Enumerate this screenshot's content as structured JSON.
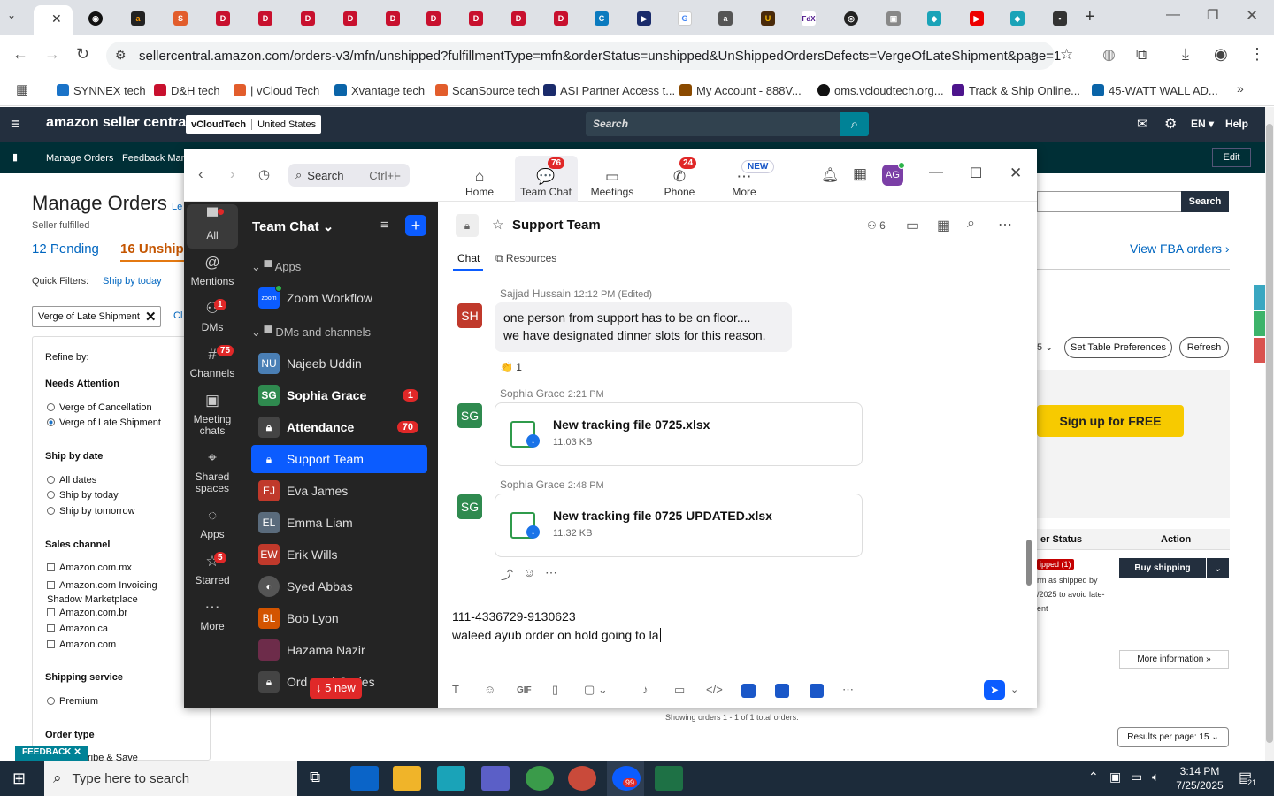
{
  "browser": {
    "url": "sellercentral.amazon.com/orders-v3/mfn/unshipped?fulfillmentType=mfn&orderStatus=unshipped&UnShippedOrdersDefects=VergeOfLateShipment&page=1",
    "bookmarks": [
      "SYNNEX tech",
      "D&H tech",
      "| vCloud Tech",
      "Xvantage tech",
      "ScanSource tech",
      "ASI Partner Access t...",
      "My Account - 888V...",
      "oms.vcloudtech.org...",
      "Track & Ship Online...",
      "45-WATT WALL AD..."
    ]
  },
  "amazon": {
    "logo": "amazon seller central",
    "store": "vCloudTech",
    "marketplace": "United States",
    "search_placeholder": "Search",
    "lang": "EN",
    "help": "Help",
    "nav": [
      "Manage Orders",
      "Feedback Man"
    ],
    "edit": "Edit",
    "page_title": "Manage Orders",
    "learn": "Le",
    "seller_fulfilled": "Seller fulfilled",
    "pending": "12 Pending",
    "unshipped": "16 Unship",
    "quick_filters": "Quick Filters:",
    "ship_today": "Ship by today",
    "filter_chip": "Verge of Late Shipment",
    "clear": "Cl",
    "search_btn": "Search",
    "view_fba": "View FBA orders ›",
    "refine_by": "Refine by:",
    "needs_attention": "Needs Attention",
    "verge_cancel": "Verge of Cancellation",
    "verge_late": "Verge of Late Shipment",
    "ship_by_date": "Ship by date",
    "all_dates": "All dates",
    "ship_today_opt": "Ship by today",
    "ship_tomorrow": "Ship by tomorrow",
    "sales_channel": "Sales channel",
    "channels": [
      "Amazon.com.mx",
      "Amazon.com Invoicing Shadow Marketplace",
      "Amazon.com.br",
      "Amazon.ca",
      "Amazon.com"
    ],
    "shipping_service": "Shipping service",
    "premium": "Premium",
    "order_type": "Order type",
    "subscribe": "scribe & Save",
    "feedback": "FEEDBACK",
    "per_page_partial": "5",
    "table_prefs": "Set Table Preferences",
    "refresh": "Refresh",
    "signup": "Sign up for FREE",
    "status_col": "er Status",
    "action_col": "Action",
    "status_badge": "ipped (1)",
    "status_note": "rm as shipped by /2025 to avoid late- ent",
    "buy_shipping": "Buy shipping",
    "more_info": "More information »",
    "showing": "Showing orders 1 - 1 of 1 total orders.",
    "results_per_page": "Results per page: 15"
  },
  "zoom": {
    "search_label": "Search",
    "search_shortcut": "Ctrl+F",
    "tabs": [
      {
        "label": "Home"
      },
      {
        "label": "Team Chat",
        "badge": "76"
      },
      {
        "label": "Meetings"
      },
      {
        "label": "Phone",
        "badge": "24"
      },
      {
        "label": "More",
        "badge": "NEW"
      }
    ],
    "avatar": "AG",
    "rail": [
      {
        "label": "All"
      },
      {
        "label": "Mentions"
      },
      {
        "label": "DMs",
        "badge": "1"
      },
      {
        "label": "Channels",
        "badge": "75"
      },
      {
        "label": "Meeting chats"
      },
      {
        "label": "Shared spaces"
      },
      {
        "label": "Apps"
      },
      {
        "label": "Starred",
        "badge": "5"
      },
      {
        "label": "More"
      }
    ],
    "list_title": "Team Chat",
    "section_apps": "Apps",
    "zoom_workflow": "Zoom Workflow",
    "section_dms": "DMs and channels",
    "contacts": [
      {
        "initials": "NU",
        "name": "Najeeb Uddin",
        "color": "#4a7fb5"
      },
      {
        "initials": "SG",
        "name": "Sophia Grace",
        "color": "#2f8a4f",
        "count": "1"
      },
      {
        "initials": "",
        "name": "Attendance",
        "color": "#444",
        "count": "70"
      },
      {
        "initials": "",
        "name": "Support Team",
        "color": "#1a73e8"
      },
      {
        "initials": "EJ",
        "name": "Eva James",
        "color": "#c0392b"
      },
      {
        "initials": "EL",
        "name": "Emma Liam",
        "color": "#5a6b7c"
      },
      {
        "initials": "EW",
        "name": "Erik Wills",
        "color": "#c0392b"
      },
      {
        "initials": "",
        "name": "Syed Abbas",
        "color": "#555"
      },
      {
        "initials": "BL",
        "name": "Bob Lyon",
        "color": "#d35400"
      },
      {
        "initials": "",
        "name": "Hazama Nazir",
        "color": "#6d2c4a"
      },
      {
        "initials": "",
        "name": "Ord      d Quries",
        "color": "#444"
      }
    ],
    "new_pill": "↓ 5 new",
    "channel_name": "Support Team",
    "members": "6",
    "chat_tab": "Chat",
    "resources_tab": "Resources",
    "messages": [
      {
        "initials": "SH",
        "sender": "Sajjad Hussain",
        "time": "12:12 PM (Edited)",
        "lines": [
          "one person from support has to be on floor....",
          "we have designated dinner slots for this reason."
        ],
        "reaction": "1"
      },
      {
        "initials": "SG",
        "sender": "Sophia Grace",
        "time": "2:21 PM",
        "file": "New tracking file 0725.xlsx",
        "size": "11.03 KB"
      },
      {
        "initials": "SG",
        "sender": "Sophia Grace",
        "time": "2:48 PM",
        "file": "New tracking file 0725 UPDATED.xlsx",
        "size": "11.32 KB"
      }
    ],
    "compose_line1": "111-4336729-9130623",
    "compose_line2": "waleed ayub order on hold going to la",
    "gif": "GIF"
  },
  "taskbar": {
    "search": "Type here to search",
    "time": "3:14 PM",
    "date": "7/25/2025",
    "notif": "21",
    "zoom_badge": "99"
  }
}
